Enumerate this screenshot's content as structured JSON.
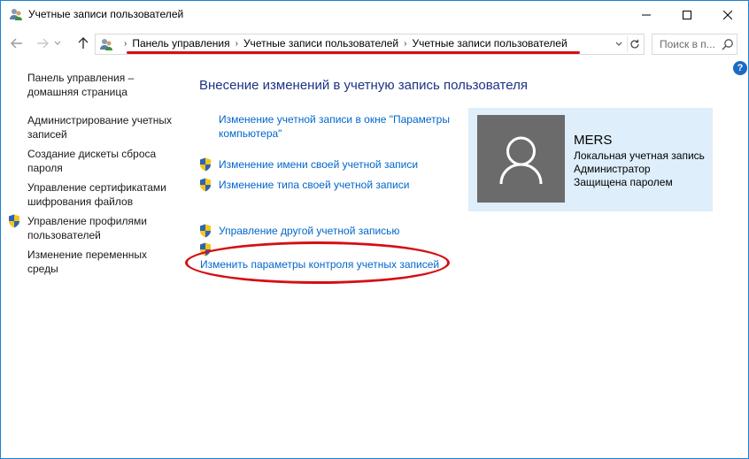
{
  "window": {
    "title": "Учетные записи пользователей"
  },
  "address": {
    "breadcrumbs": [
      "Панель управления",
      "Учетные записи пользователей",
      "Учетные записи пользователей"
    ]
  },
  "search": {
    "placeholder": "Поиск в п..."
  },
  "help": {
    "label": "?"
  },
  "sidebar": {
    "home": [
      "Панель управления –",
      "домашняя страница"
    ],
    "items": [
      {
        "lines": [
          "Администрирование учетных",
          "записей"
        ],
        "shield": false
      },
      {
        "lines": [
          "Создание дискеты сброса",
          "пароля"
        ],
        "shield": false
      },
      {
        "lines": [
          "Управление сертификатами",
          "шифрования файлов"
        ],
        "shield": false
      },
      {
        "lines": [
          "Управление профилями",
          "пользователей"
        ],
        "shield": true
      },
      {
        "lines": [
          "Изменение переменных",
          "среды"
        ],
        "shield": false
      }
    ]
  },
  "main": {
    "heading": "Внесение изменений в учетную запись пользователя",
    "tasks": [
      {
        "lines": [
          "Изменение учетной записи в окне \"Параметры",
          "компьютера\""
        ],
        "shield": false
      },
      {
        "lines": [
          "Изменение имени своей учетной записи"
        ],
        "shield": true
      },
      {
        "lines": [
          "Изменение типа своей учетной записи"
        ],
        "shield": true
      },
      {
        "lines": [
          "Управление другой учетной записью"
        ],
        "shield": true
      },
      {
        "lines": [
          "Изменить параметры контроля учетных записей"
        ],
        "shield": true
      }
    ]
  },
  "user": {
    "name": "MERS",
    "details": [
      "Локальная учетная запись",
      "Администратор",
      "Защищена паролем"
    ]
  },
  "colors": {
    "annotation": "#d40f14",
    "link": "#0066cc",
    "heading": "#1e3287",
    "card": "#deeefa"
  }
}
